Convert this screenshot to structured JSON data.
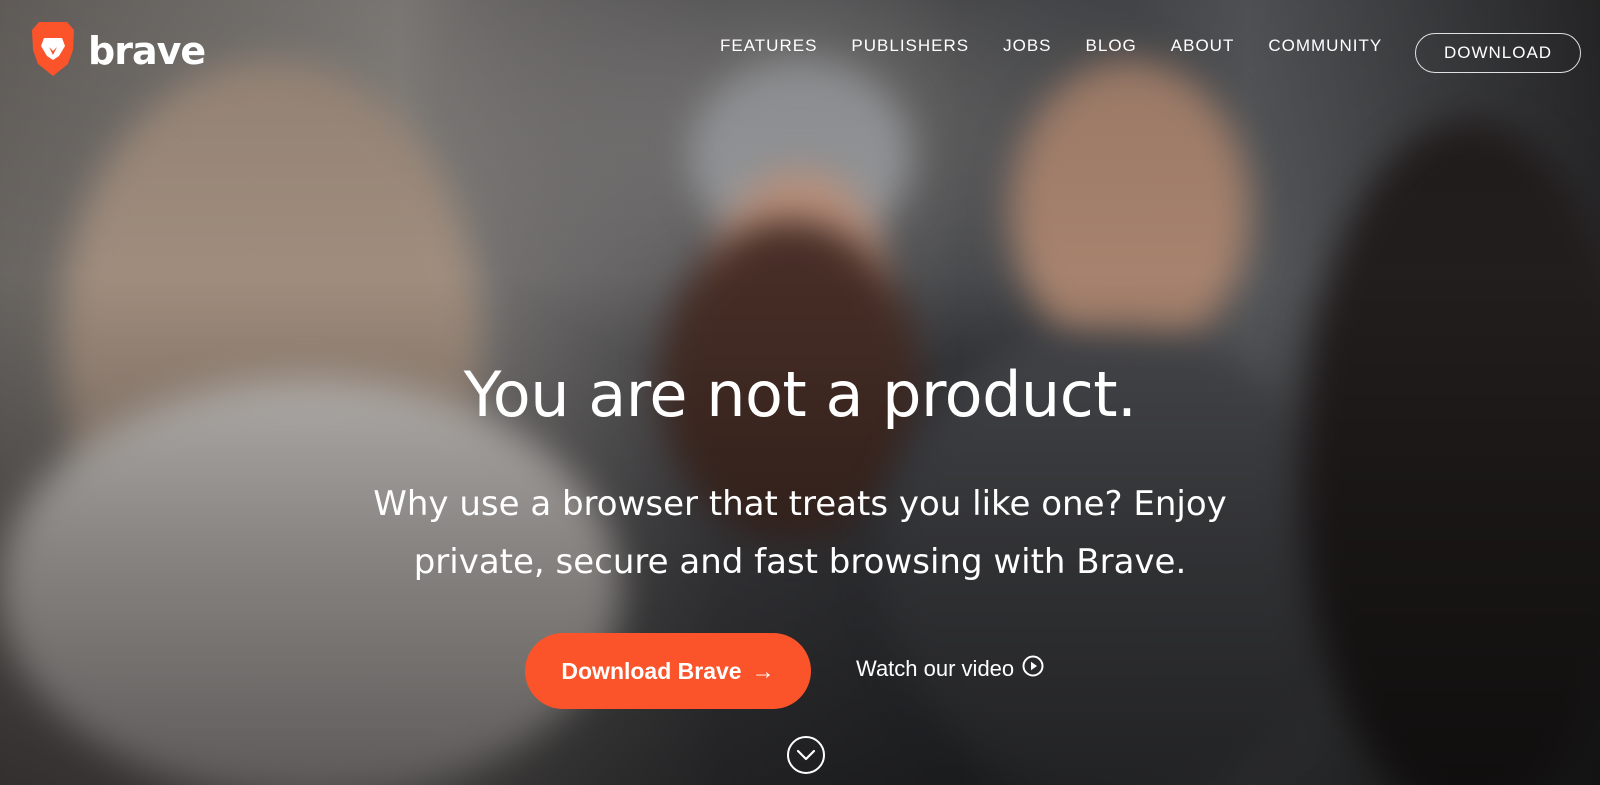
{
  "brand": {
    "name": "brave",
    "accent": "#fb542b"
  },
  "nav": {
    "items": [
      {
        "label": "FEATURES"
      },
      {
        "label": "PUBLISHERS"
      },
      {
        "label": "JOBS"
      },
      {
        "label": "BLOG"
      },
      {
        "label": "ABOUT"
      },
      {
        "label": "COMMUNITY"
      }
    ],
    "download_label": "DOWNLOAD"
  },
  "hero": {
    "headline": "You are not a product.",
    "subhead_line1": "Why use a browser that treats you like one? Enjoy",
    "subhead_line2": "private, secure and fast browsing with Brave.",
    "cta_label": "Download Brave",
    "cta_arrow": "→",
    "video_label": "Watch our video",
    "icons": {
      "logo": "brave-lion-logo-icon",
      "video": "play-circle-icon",
      "scroll": "chevron-down-circle-icon"
    }
  }
}
